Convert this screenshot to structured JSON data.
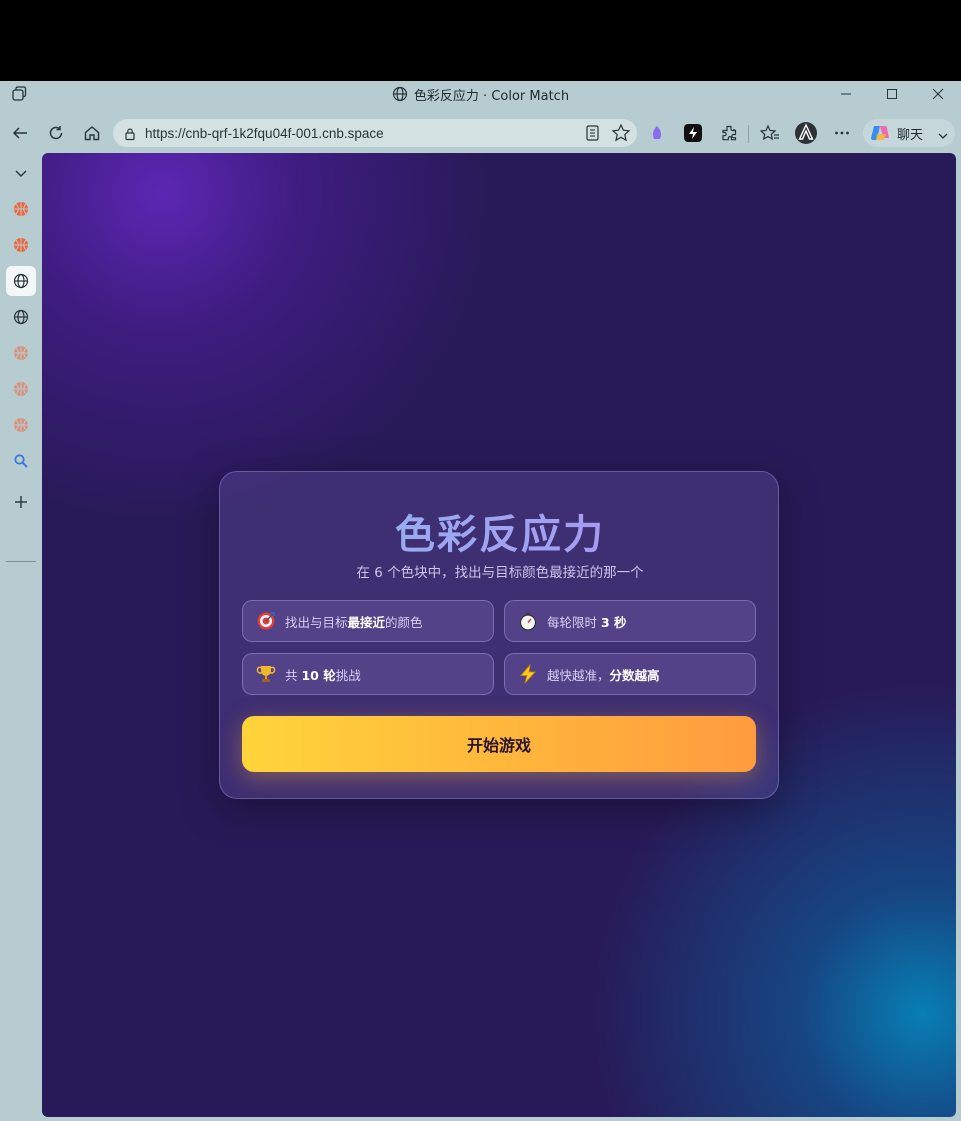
{
  "window": {
    "title": "色彩反应力 · Color Match"
  },
  "address_bar": {
    "url": "https://cnb-qrf-1k2fqu04f-001.cnb.space"
  },
  "copilot": {
    "label": "聊天"
  },
  "game": {
    "title": "色彩反应力",
    "subtitle": "在 6 个色块中，找出与目标颜色最接近的那一个",
    "rules": [
      {
        "icon": "target-icon",
        "prefix": "找出与目标",
        "bold": "最接近",
        "suffix": "的颜色"
      },
      {
        "icon": "stopwatch-icon",
        "prefix": "每轮限时 ",
        "bold": "3 秒",
        "suffix": ""
      },
      {
        "icon": "trophy-icon",
        "prefix": "共 ",
        "bold": "10 轮",
        "suffix": "挑战"
      },
      {
        "icon": "lightning-icon",
        "prefix": "越快越准，",
        "bold": "分数越高",
        "suffix": ""
      }
    ],
    "start_button": "开始游戏"
  },
  "colors": {
    "button_start": "#ffd43a",
    "button_end": "#ff9b3e",
    "background": "#281a58"
  }
}
